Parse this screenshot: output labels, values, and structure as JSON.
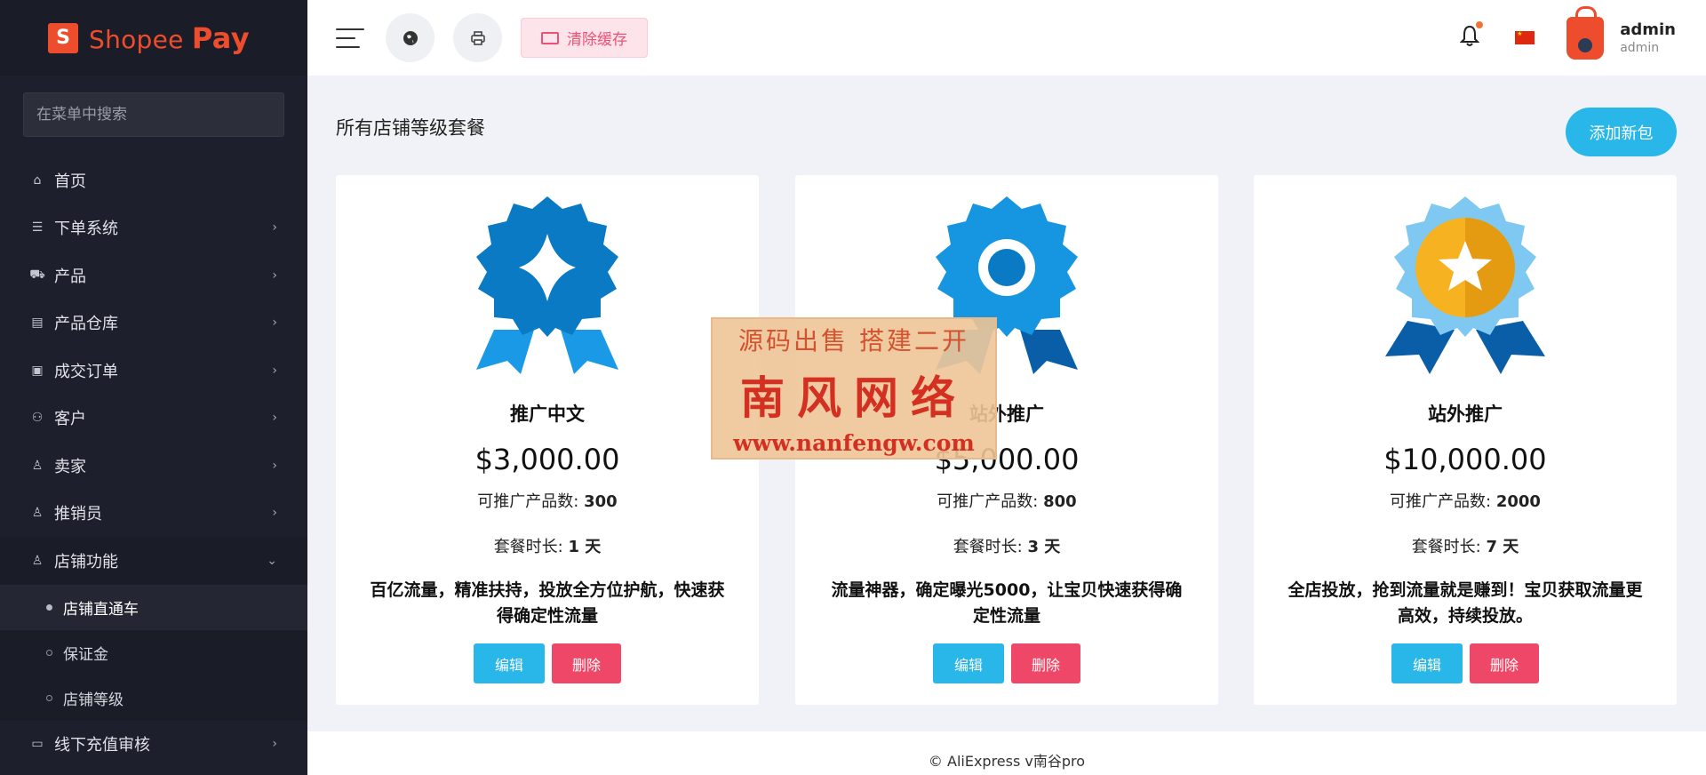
{
  "brand": {
    "logo_letter": "S",
    "name": "Shopee",
    "name_bold": "Pay"
  },
  "sidebar": {
    "search_placeholder": "在菜单中搜索",
    "items": [
      {
        "label": "首页",
        "icon": "home-icon",
        "has_children": false
      },
      {
        "label": "下单系统",
        "icon": "list-icon",
        "has_children": true
      },
      {
        "label": "产品",
        "icon": "cart-icon",
        "has_children": true
      },
      {
        "label": "产品仓库",
        "icon": "box-icon",
        "has_children": true
      },
      {
        "label": "成交订单",
        "icon": "money-icon",
        "has_children": true
      },
      {
        "label": "客户",
        "icon": "users-icon",
        "has_children": true
      },
      {
        "label": "卖家",
        "icon": "user-icon",
        "has_children": true
      },
      {
        "label": "推销员",
        "icon": "user-icon",
        "has_children": true
      },
      {
        "label": "店铺功能",
        "icon": "user-icon",
        "has_children": true,
        "open": true
      },
      {
        "label": "线下充值审核",
        "icon": "card-icon",
        "has_children": true
      }
    ],
    "submenu": [
      {
        "label": "店铺直通车",
        "active": true
      },
      {
        "label": "保证金",
        "active": false
      },
      {
        "label": "店铺等级",
        "active": false
      }
    ]
  },
  "topbar": {
    "clear_cache": "清除缓存",
    "user": {
      "name": "admin",
      "role": "admin"
    }
  },
  "main": {
    "title": "所有店铺等级套餐",
    "add_button": "添加新包",
    "cards": [
      {
        "title": "推广中文",
        "price": "$3,000.00",
        "count_label": "可推广产品数:",
        "count": "300",
        "duration_label": "套餐时长:",
        "duration": "1 天",
        "desc": "百亿流量，精准扶持，投放全方位护航，快速获得确定性流量",
        "edit": "编辑",
        "delete": "删除",
        "medal_color": "#0a7ac4"
      },
      {
        "title": "站外推广",
        "price": "$5,000.00",
        "count_label": "可推广产品数:",
        "count": "800",
        "duration_label": "套餐时长:",
        "duration": "3 天",
        "desc": "流量神器，确定曝光5000，让宝贝快速获得确定性流量",
        "edit": "编辑",
        "delete": "删除",
        "medal_color": "#1696e0"
      },
      {
        "title": "站外推广",
        "price": "$10,000.00",
        "count_label": "可推广产品数:",
        "count": "2000",
        "duration_label": "套餐时长:",
        "duration": "7 天",
        "desc": "全店投放，抢到流量就是赚到！宝贝获取流量更高效，持续投放。",
        "edit": "编辑",
        "delete": "删除",
        "medal_color": "#f2b01e"
      }
    ]
  },
  "watermark": {
    "line1": "源码出售  搭建二开",
    "line2": "南风网络",
    "line3": "www.nanfengw.com"
  },
  "footer": "© AliExpress v南谷pro"
}
